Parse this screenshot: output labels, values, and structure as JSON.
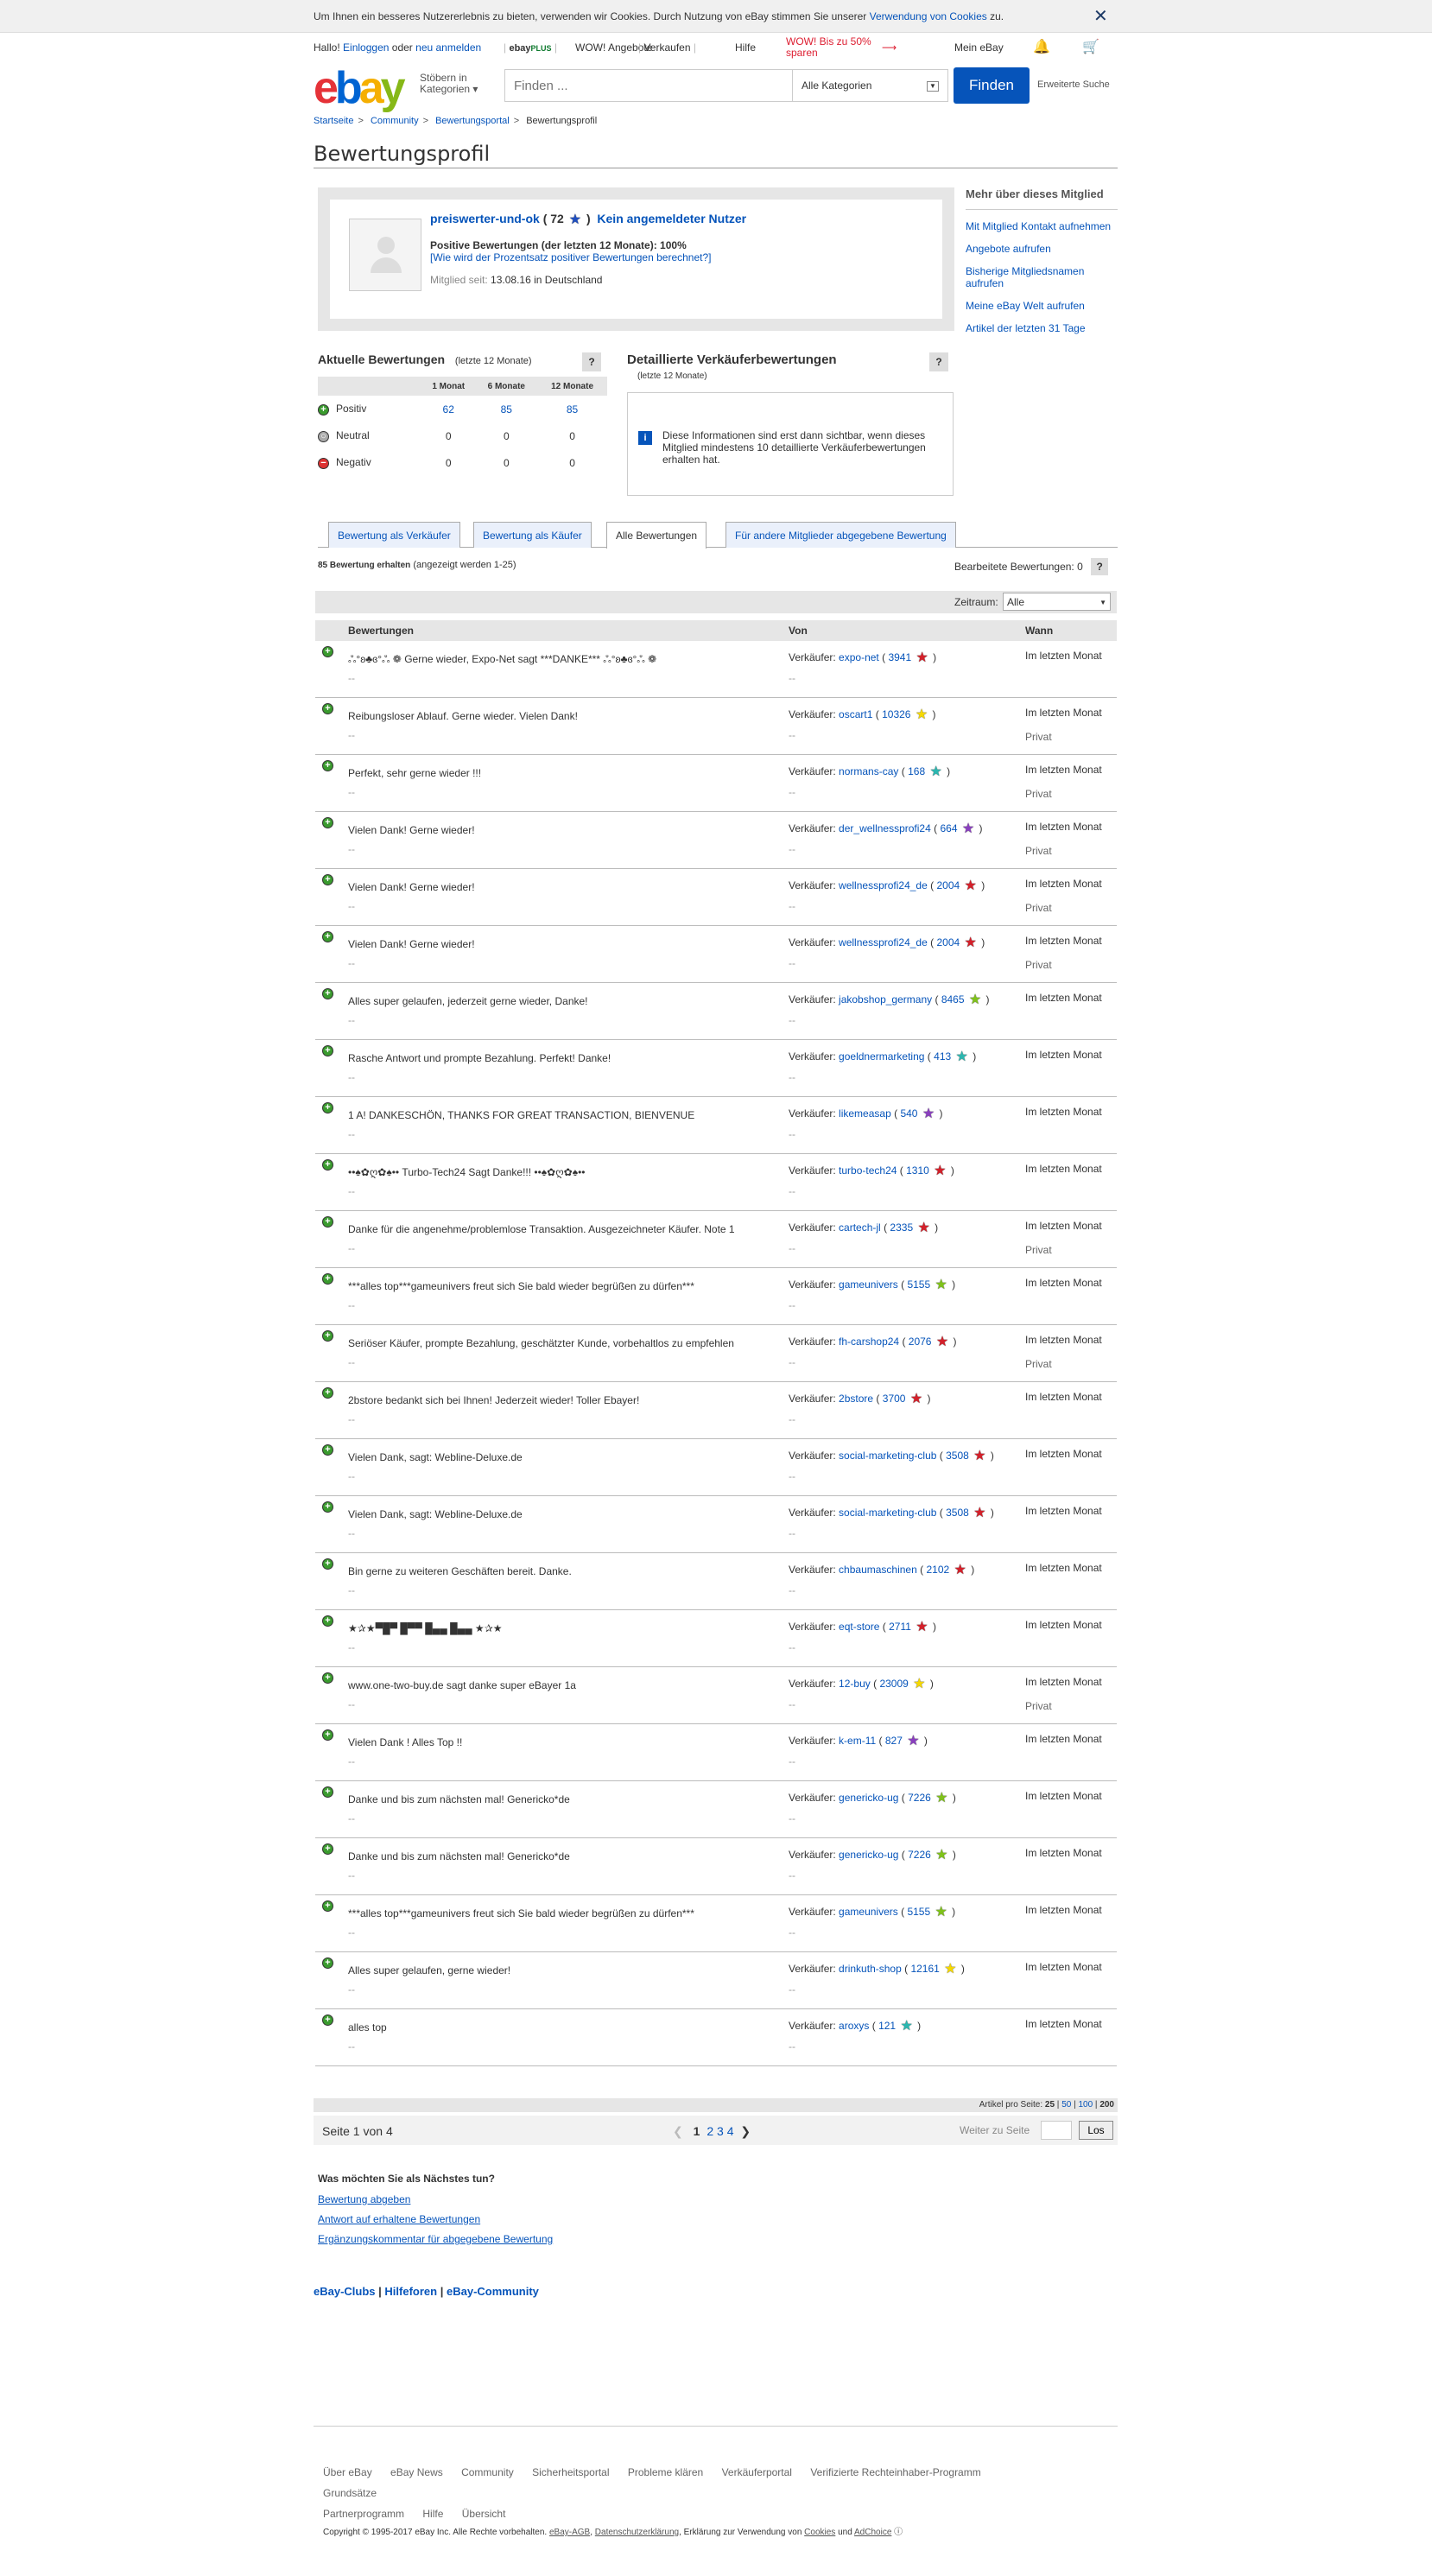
{
  "cookie": {
    "text": "Um Ihnen ein besseres Nutzererlebnis zu bieten, verwenden wir Cookies. Durch Nutzung von eBay stimmen Sie unserer",
    "link": "Verwendung von Cookies",
    "suffix": "zu."
  },
  "topnav": {
    "hello": "Hallo!",
    "login": "Einloggen",
    "or": "oder",
    "register": "neu anmelden",
    "plus_a": "ebay",
    "plus_b": "PLUS",
    "wow": "WOW! Angebote",
    "sell": "Verkaufen",
    "help": "Hilfe",
    "promo_1": "WOW! Bis zu 50%",
    "promo_2": "sparen",
    "myebay": "Mein eBay"
  },
  "header": {
    "browse_1": "Stöbern in",
    "browse_2": "Kategorien",
    "search_placeholder": "Finden ...",
    "category": "Alle Kategorien",
    "find": "Finden",
    "advanced": "Erweiterte Suche"
  },
  "breadcrumb": [
    "Startseite",
    "Community",
    "Bewertungsportal",
    "Bewertungsprofil"
  ],
  "page_title": "Bewertungsprofil",
  "profile": {
    "username": "preiswerter-und-ok",
    "score_open": "( 72",
    "score_close": ")",
    "not_logged": "Kein angemeldeter Nutzer",
    "positive": "Positive Bewertungen (der letzten 12 Monate): 100%",
    "calc_link": "[Wie wird der Prozentsatz positiver Bewertungen berechnet?]",
    "since_label": "Mitglied seit:",
    "since_value": "13.08.16 in Deutschland"
  },
  "sidebar": {
    "title": "Mehr über dieses Mitglied",
    "links": [
      "Mit Mitglied Kontakt aufnehmen",
      "Angebote aufrufen",
      "Bisherige Mitgliedsnamen aufrufen",
      "Meine eBay Welt aufrufen",
      "Artikel der letzten 31 Tage"
    ]
  },
  "current": {
    "title": "Aktuelle Bewertungen",
    "sub": "(letzte 12 Monate)",
    "help": "?",
    "cols": [
      "1 Monat",
      "6 Monate",
      "12 Monate"
    ],
    "rows": [
      {
        "label": "Positiv",
        "values": [
          "62",
          "85",
          "85"
        ]
      },
      {
        "label": "Neutral",
        "values": [
          "0",
          "0",
          "0"
        ]
      },
      {
        "label": "Negativ",
        "values": [
          "0",
          "0",
          "0"
        ]
      }
    ]
  },
  "detailed": {
    "title": "Detaillierte Verkäuferbewertungen",
    "sub": "(letzte 12 Monate)",
    "help": "?",
    "info_icon": "i",
    "message": "Diese Informationen sind erst dann sichtbar, wenn dieses Mitglied mindestens 10 detaillierte Verkäuferbewertungen erhalten hat."
  },
  "tabs": [
    "Bewertung als Verkäufer",
    "Bewertung als Käufer",
    "Alle Bewertungen",
    "Für andere Mitglieder abgegebene Bewertung"
  ],
  "received": {
    "count": "85 Bewertung erhalten",
    "shown": "(angezeigt werden 1-25)"
  },
  "edited": "Bearbeitete Bewertungen: 0",
  "timeframe": {
    "label": "Zeitraum:",
    "value": "Alle"
  },
  "feedback_headers": [
    "Bewertungen",
    "Von",
    "Wann"
  ],
  "seller_label": "Verkäufer:",
  "dash": "--",
  "when_value": "Im letzten Monat",
  "private": "Privat",
  "feedback": [
    {
      "comment": "ஃ°ʚ♣ɞ°ஃ ❁ Gerne wieder, Expo-Net sagt ***DANKE*** ஃ°ʚ♣ɞ°ஃ ❁",
      "seller": "expo-net",
      "score": "3941",
      "star_color": "#d4202a",
      "private": false
    },
    {
      "comment": "Reibungsloser Ablauf. Gerne wieder. Vielen Dank!",
      "seller": "oscart1",
      "score": "10326",
      "star_color": "#f5d800",
      "private": true
    },
    {
      "comment": "Perfekt, sehr gerne wieder !!!",
      "seller": "normans-cay",
      "score": "168",
      "star_color": "#2bb7b0",
      "private": true
    },
    {
      "comment": "Vielen Dank! Gerne wieder!",
      "seller": "der_wellnessprofi24",
      "score": "664",
      "star_color": "#8a3fbf",
      "private": true
    },
    {
      "comment": "Vielen Dank! Gerne wieder!",
      "seller": "wellnessprofi24_de",
      "score": "2004",
      "star_color": "#d4202a",
      "private": true
    },
    {
      "comment": "Vielen Dank! Gerne wieder!",
      "seller": "wellnessprofi24_de",
      "score": "2004",
      "star_color": "#d4202a",
      "private": true
    },
    {
      "comment": "Alles super gelaufen, jederzeit gerne wieder, Danke!",
      "seller": "jakobshop_germany",
      "score": "8465",
      "star_color": "#7fc21a",
      "private": false
    },
    {
      "comment": "Rasche Antwort und prompte Bezahlung. Perfekt! Danke!",
      "seller": "goeldnermarketing",
      "score": "413",
      "star_color": "#2bb7b0",
      "private": false
    },
    {
      "comment": "1 A! DANKESCHÖN, THANKS FOR GREAT TRANSACTION, BIENVENUE",
      "seller": "likemeasap",
      "score": "540",
      "star_color": "#8a3fbf",
      "private": false
    },
    {
      "comment": "••♠✿ღ✿♠•• Turbo-Tech24 Sagt Danke!!! ••♠✿ღ✿♠••",
      "seller": "turbo-tech24",
      "score": "1310",
      "star_color": "#d4202a",
      "private": false
    },
    {
      "comment": "Danke für die angenehme/problemlose Transaktion. Ausgezeichneter Käufer. Note 1",
      "seller": "cartech-jl",
      "score": "2335",
      "star_color": "#d4202a",
      "private": true
    },
    {
      "comment": "***alles top***gameunivers freut sich Sie bald wieder begrüßen zu dürfen***",
      "seller": "gameunivers",
      "score": "5155",
      "star_color": "#7fc21a",
      "private": false
    },
    {
      "comment": "Seriöser Käufer, prompte Bezahlung, geschätzter Kunde, vorbehaltlos zu empfehlen",
      "seller": "fh-carshop24",
      "score": "2076",
      "star_color": "#d4202a",
      "private": true
    },
    {
      "comment": "2bstore bedankt sich bei Ihnen! Jederzeit wieder! Toller Ebayer!",
      "seller": "2bstore",
      "score": "3700",
      "star_color": "#d4202a",
      "private": false
    },
    {
      "comment": "Vielen Dank, sagt: Webline-Deluxe.de",
      "seller": "social-marketing-club",
      "score": "3508",
      "star_color": "#d4202a",
      "private": false
    },
    {
      "comment": "Vielen Dank, sagt: Webline-Deluxe.de",
      "seller": "social-marketing-club",
      "score": "3508",
      "star_color": "#d4202a",
      "private": false
    },
    {
      "comment": "Bin gerne zu weiteren Geschäften bereit. Danke.",
      "seller": "chbaumaschinen",
      "score": "2102",
      "star_color": "#d4202a",
      "private": false
    },
    {
      "comment": "★✰★▀█▀ █▀▀ █▄▄ █▄▄ ★✰★",
      "seller": "eqt-store",
      "score": "2711",
      "star_color": "#d4202a",
      "private": false
    },
    {
      "comment": "www.one-two-buy.de sagt danke super eBayer 1a",
      "seller": "12-buy",
      "score": "23009",
      "star_color": "#f5d800",
      "private": true
    },
    {
      "comment": "Vielen Dank ! Alles Top !!",
      "seller": "k-em-11",
      "score": "827",
      "star_color": "#8a3fbf",
      "private": false
    },
    {
      "comment": "Danke und bis zum nächsten mal! Genericko*de",
      "seller": "genericko-ug",
      "score": "7226",
      "star_color": "#7fc21a",
      "private": false
    },
    {
      "comment": "Danke und bis zum nächsten mal! Genericko*de",
      "seller": "genericko-ug",
      "score": "7226",
      "star_color": "#7fc21a",
      "private": false
    },
    {
      "comment": "***alles top***gameunivers freut sich Sie bald wieder begrüßen zu dürfen***",
      "seller": "gameunivers",
      "score": "5155",
      "star_color": "#7fc21a",
      "private": false
    },
    {
      "comment": "Alles super gelaufen, gerne wieder!",
      "seller": "drinkuth-shop",
      "score": "12161",
      "star_color": "#f5d800",
      "private": false
    },
    {
      "comment": "alles top",
      "seller": "aroxys",
      "score": "121",
      "star_color": "#2bb7b0",
      "private": false
    }
  ],
  "per_page": {
    "label": "Artikel pro Seite:",
    "options": [
      "25",
      "50",
      "100",
      "200"
    ]
  },
  "pager": {
    "of": "Seite 1 von 4",
    "pages": [
      "1",
      "2",
      "3",
      "4"
    ],
    "goto": "Weiter zu Seite",
    "go": "Los"
  },
  "next_actions": {
    "title": "Was möchten Sie als Nächstes tun?",
    "links": [
      "Bewertung abgeben",
      "Antwort auf erhaltene Bewertungen",
      "Ergänzungskommentar für abgegebene Bewertung"
    ]
  },
  "clubs": [
    "eBay-Clubs",
    "Hilfeforen",
    "eBay-Community"
  ],
  "footer_links": [
    "Über eBay",
    "eBay News",
    "Community",
    "Sicherheitsportal",
    "Probleme klären",
    "Verkäuferportal",
    "Verifizierte Rechteinhaber-Programm",
    "Grundsätze",
    "Partnerprogramm",
    "Hilfe",
    "Übersicht"
  ],
  "copyright": {
    "text": "Copyright © 1995-2017 eBay Inc. Alle Rechte vorbehalten.",
    "agb": "eBay-AGB",
    "privacy": "Datenschutzerklärung",
    "cookies_text": "Erklärung zur Verwendung von",
    "cookies": "Cookies",
    "and": "und",
    "adchoice": "AdChoice"
  },
  "colors": {
    "link": "#0654ba",
    "positive": "#3a9b2e",
    "find_button": "#0654ba"
  }
}
